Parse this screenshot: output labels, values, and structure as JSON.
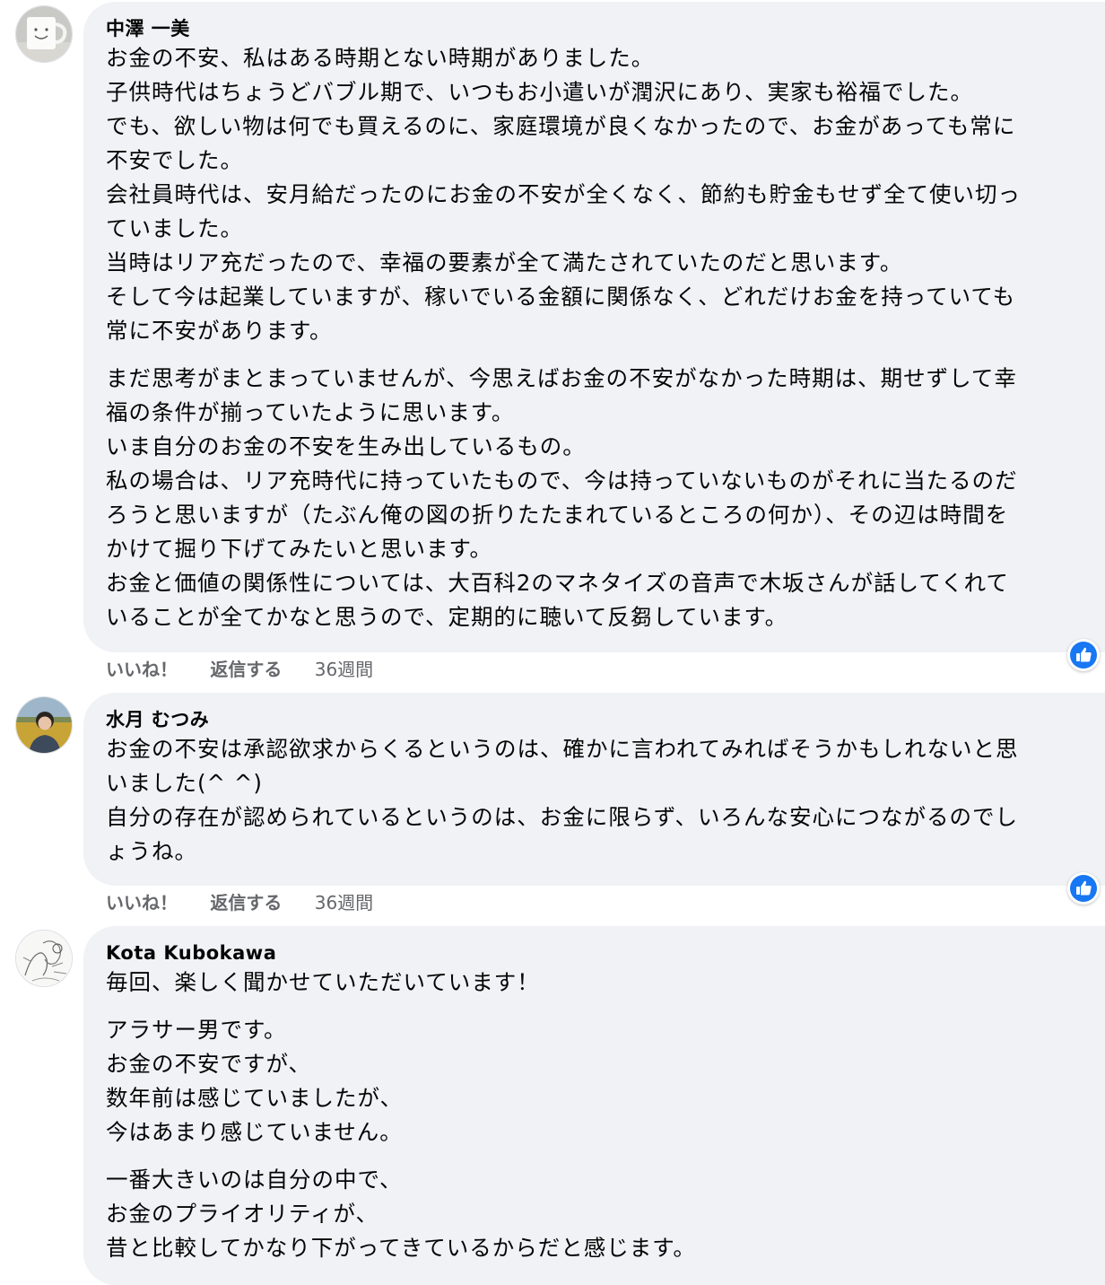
{
  "actions": {
    "like_label": "いいね！",
    "reply_label": "返信する"
  },
  "comments": [
    {
      "author": "中澤 一美",
      "avatar_icon": "mug-smiley-avatar",
      "paragraphs": [
        "お金の不安、私はある時期とない時期がありました。\n子供時代はちょうどバブル期で、いつもお小遣いが潤沢にあり、実家も裕福でした。\nでも、欲しい物は何でも買えるのに、家庭環境が良くなかったので、お金があっても常に\n不安でした。\n会社員時代は、安月給だったのにお金の不安が全くなく、節約も貯金もせず全て使い切っ\nていました。\n当時はリア充だったので、幸福の要素が全て満たされていたのだと思います。\nそして今は起業していますが、稼いでいる金額に関係なく、どれだけお金を持っていても\n常に不安があります。",
        "まだ思考がまとまっていませんが、今思えばお金の不安がなかった時期は、期せずして幸\n福の条件が揃っていたように思います。\nいま自分のお金の不安を生み出しているもの。\n私の場合は、リア充時代に持っていたもので、今は持っていないものがそれに当たるのだ\nろうと思いますが（たぶん俺の図の折りたたまれているところの何か）、その辺は時間を\nかけて掘り下げてみたいと思います。\nお金と価値の関係性については、大百科2のマネタイズの音声で木坂さんが話してくれて\nいることが全てかなと思うので、定期的に聴いて反芻しています。"
      ],
      "time": "36週間"
    },
    {
      "author": "水月 むつみ",
      "avatar_icon": "person-photo-avatar",
      "paragraphs": [
        "お金の不安は承認欲求からくるというのは、確かに言われてみればそうかもしれないと思\nいました(^ ^)\n自分の存在が認められているというのは、お金に限らず、いろんな安心につながるのでし\nょうね。"
      ],
      "time": "36週間"
    },
    {
      "author": "Kota Kubokawa",
      "avatar_icon": "sketch-drawing-avatar",
      "paragraphs": [
        "毎回、楽しく聞かせていただいています！",
        "アラサー男です。\nお金の不安ですが、\n数年前は感じていましたが、\n今はあまり感じていません。",
        "一番大きいのは自分の中で、\nお金のプライオリティが、\n昔と比較してかなり下がってきているからだと感じます。"
      ]
    }
  ],
  "colors": {
    "bubble": "#f0f2f5",
    "meta_text": "#65676b",
    "like_blue": "#1877f2"
  }
}
